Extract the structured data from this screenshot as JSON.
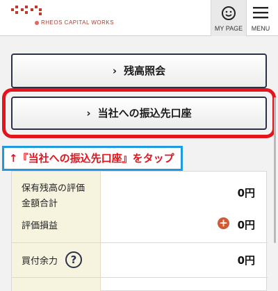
{
  "header": {
    "brand": "RHEOS CAPITAL WORKS",
    "mypage_label": "MY PAGE",
    "menu_label": "MENU"
  },
  "buttons": {
    "balance_inquiry": "残高照会",
    "transfer_account": "当社への振込先口座",
    "chevron": "›"
  },
  "callout": {
    "text": "↑『当社への振込先口座』をタップ"
  },
  "summary": {
    "valuation_label": "保有残高の評価\n金額合計",
    "valuation_value": "0円",
    "pl_label": "評価損益",
    "pl_value": "0円",
    "pl_sign": "+",
    "buying_power_label": "買付余力",
    "buying_power_value": "0円",
    "help_symbol": "?"
  },
  "colors": {
    "brand": "#b03a2e",
    "highlight": "#e3141b",
    "callout_border": "#1e9be0",
    "button_border": "#2b3045",
    "plus_badge": "#d05a32"
  }
}
